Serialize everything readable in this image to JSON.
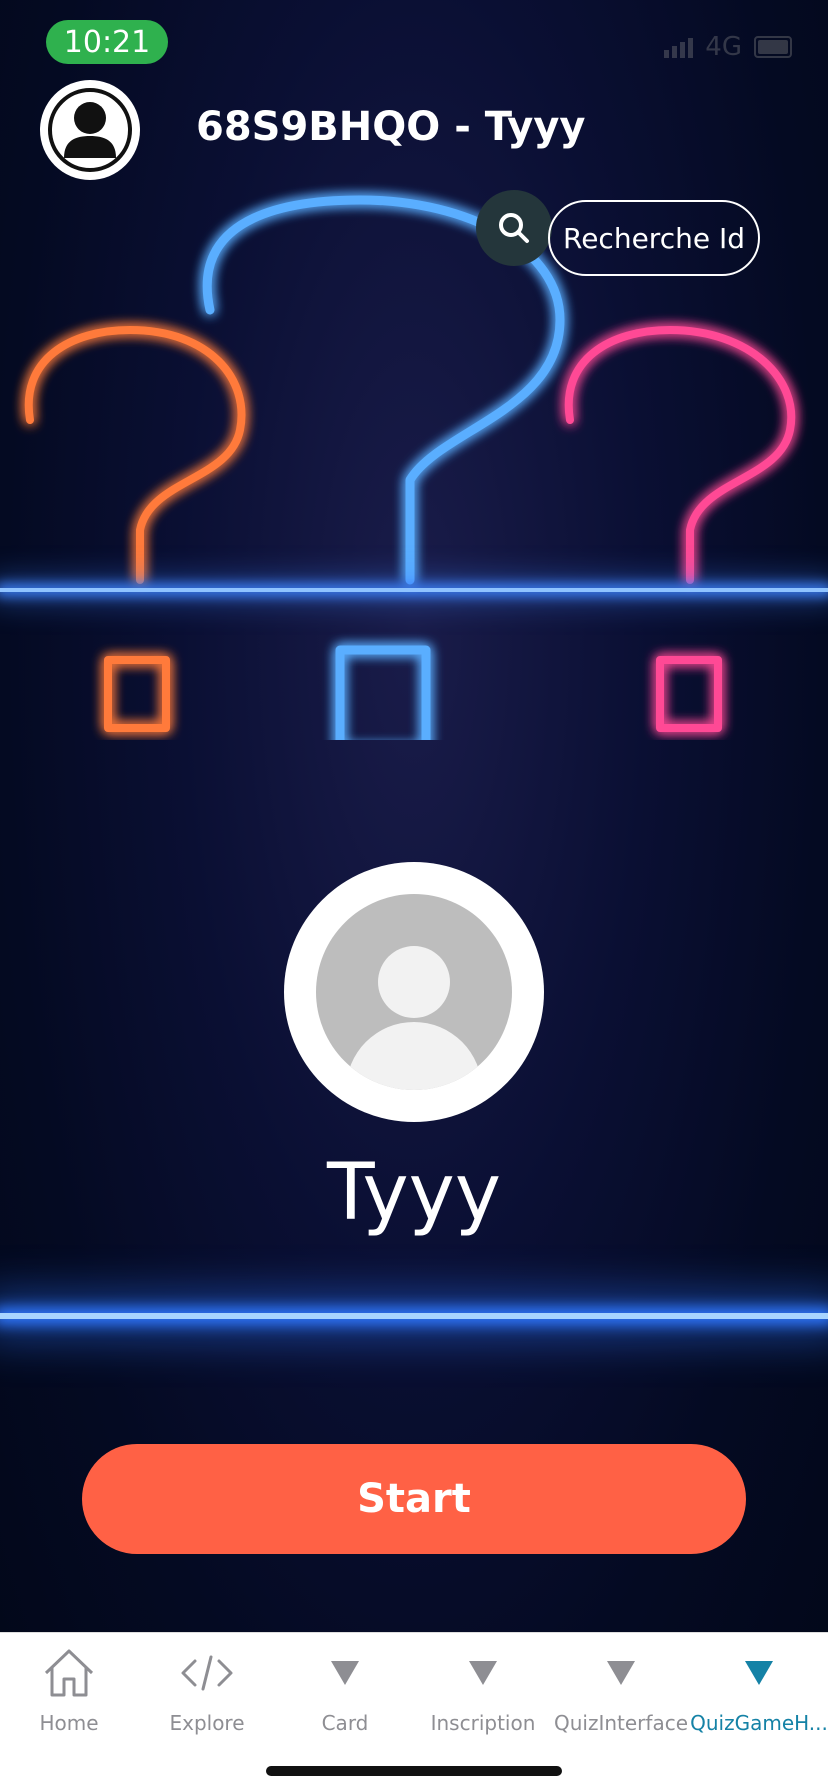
{
  "status": {
    "time": "10:21",
    "network": "4G"
  },
  "header": {
    "title": "68S9BHQO - Tyyy"
  },
  "search": {
    "button_label": "Recherche Id"
  },
  "profile": {
    "name": "Tyyy"
  },
  "actions": {
    "start_label": "Start"
  },
  "tabs": [
    {
      "label": "Home",
      "icon": "home-icon"
    },
    {
      "label": "Explore",
      "icon": "code-icon"
    },
    {
      "label": "Card",
      "icon": "triangle-icon"
    },
    {
      "label": "Inscription",
      "icon": "triangle-icon"
    },
    {
      "label": "QuizInterface",
      "icon": "triangle-icon"
    },
    {
      "label": "QuizGameH...",
      "icon": "triangle-icon",
      "active": true
    }
  ],
  "colors": {
    "status_pill": "#2fb14e",
    "start_button": "#ff6145",
    "active_tab": "#1582a6",
    "neon_orange": "#ff6a2a",
    "neon_blue": "#4aa0ff",
    "neon_pink": "#ff3a8a"
  }
}
